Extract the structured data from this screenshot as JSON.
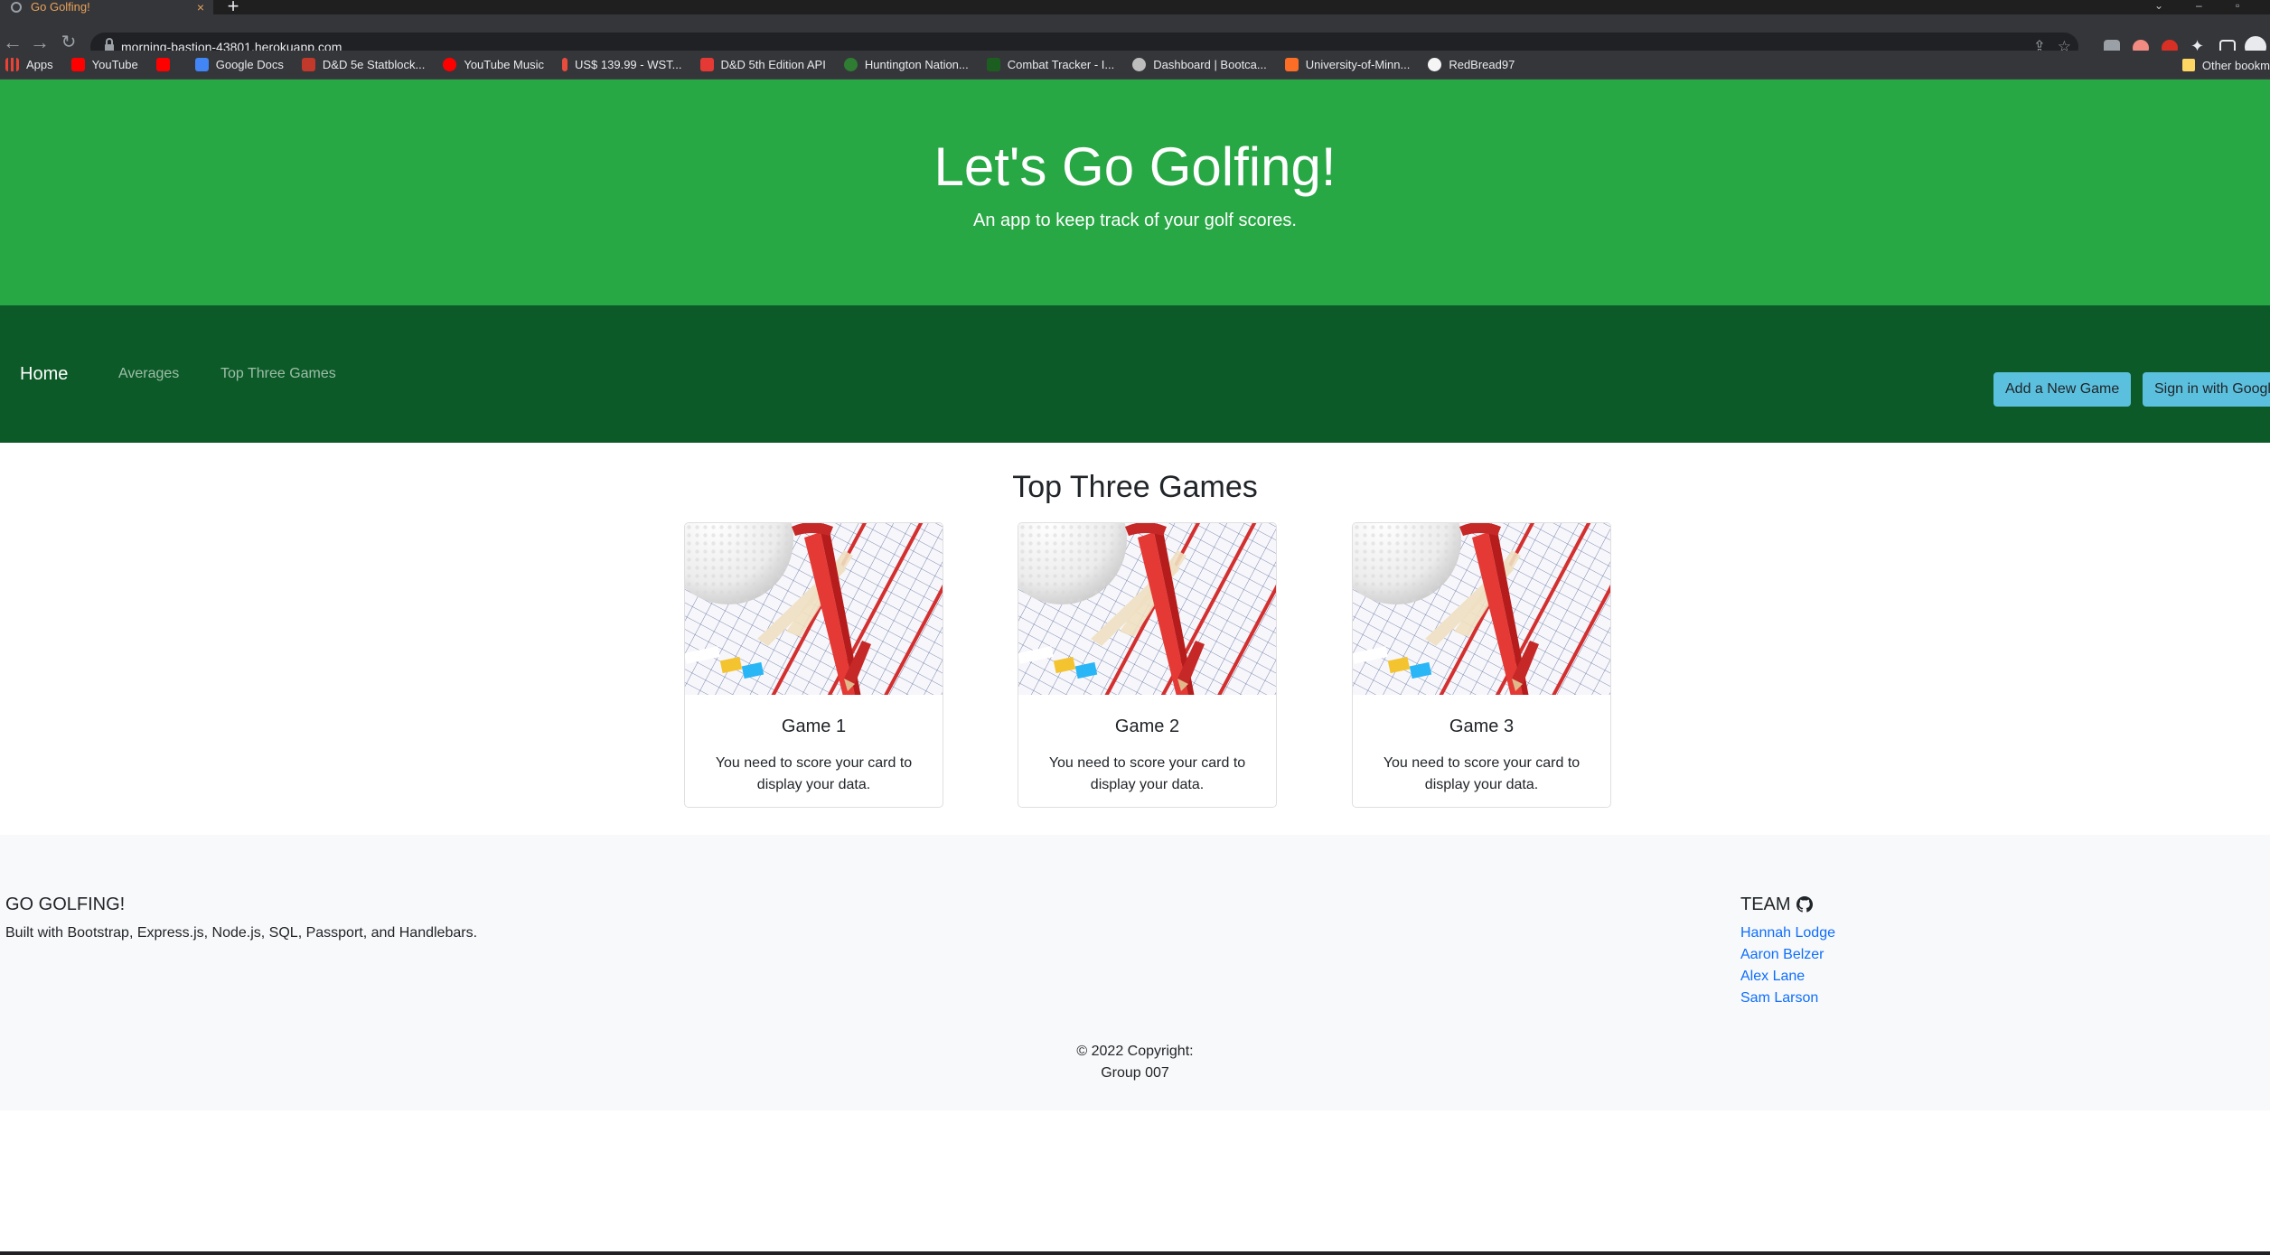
{
  "browser": {
    "tab_title": "Go Golfing!",
    "tab_close": "×",
    "new_tab": "+",
    "url": "morning-bastion-43801.herokuapp.com",
    "bookmarks": [
      {
        "label": "Apps",
        "color": "#ea4335"
      },
      {
        "label": "YouTube",
        "color": "#ff0000"
      },
      {
        "label": "",
        "color": "#ff0000"
      },
      {
        "label": "Google Docs",
        "color": "#4285f4"
      },
      {
        "label": "D&D 5e Statblock...",
        "color": "#c0392b"
      },
      {
        "label": "YouTube Music",
        "color": "#ff0000"
      },
      {
        "label": "US$ 139.99 - WST...",
        "color": "#e74c3c"
      },
      {
        "label": "D&D 5th Edition API",
        "color": "#e53935"
      },
      {
        "label": "Huntington Nation...",
        "color": "#2e7d32"
      },
      {
        "label": "Combat Tracker - I...",
        "color": "#1b5e20"
      },
      {
        "label": "Dashboard | Bootca...",
        "color": "#bdbdbd"
      },
      {
        "label": "University-of-Minn...",
        "color": "#fc6d26"
      },
      {
        "label": "RedBread97",
        "color": "#f5f5f5"
      }
    ],
    "other_bookmarks": "Other bookm"
  },
  "hero": {
    "title": "Let's Go Golfing!",
    "subtitle": "An app to keep track of your golf scores."
  },
  "nav": {
    "brand": "Home",
    "links": [
      "Averages",
      "Top Three Games"
    ],
    "add_game": "Add a New Game",
    "sign_in": "Sign in with Googl"
  },
  "main": {
    "title": "Top Three Games",
    "cards": [
      {
        "title": "Game 1",
        "text": "You need to score your card to display your data."
      },
      {
        "title": "Game 2",
        "text": "You need to score your card to display your data."
      },
      {
        "title": "Game 3",
        "text": "You need to score your card to display your data."
      }
    ]
  },
  "footer": {
    "brand": "GO GOLFING!",
    "description": "Built with Bootstrap, Express.js, Node.js, SQL, Passport, and Handlebars.",
    "team_heading": "TEAM",
    "team": [
      "Hannah Lodge",
      "Aaron Belzer",
      "Alex Lane",
      "Sam Larson"
    ],
    "copyright_line1": "© 2022 Copyright:",
    "copyright_line2": "Group 007"
  },
  "colors": {
    "hero_green": "#28a745",
    "nav_green": "#0b5a27",
    "button_info": "#5bc0de",
    "link_blue": "#0d6efd"
  }
}
